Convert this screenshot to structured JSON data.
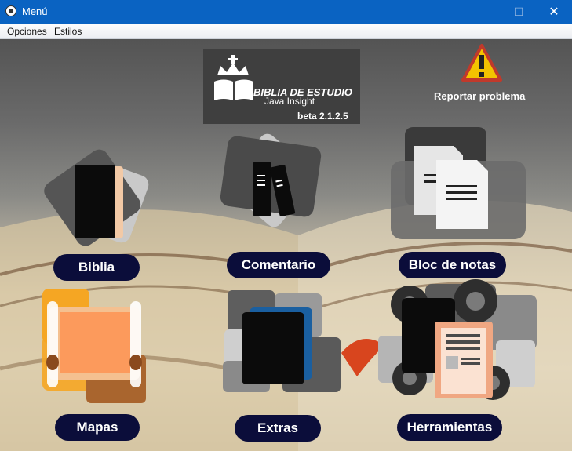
{
  "window": {
    "title": "Menú",
    "minimize": "—",
    "maximize": "☐",
    "close": "✕"
  },
  "menubar": {
    "items": [
      "Opciones",
      "Estilos"
    ]
  },
  "logo": {
    "title": "BIBLIA DE ESTUDIO",
    "subtitle": "Java Insight",
    "version": "beta 2.1.2.5"
  },
  "report": {
    "label": "Reportar problema",
    "icon": "warning-icon"
  },
  "tiles": {
    "biblia": {
      "label": "Biblia",
      "icon": "bible-book-icon"
    },
    "comentario": {
      "label": "Comentario",
      "icon": "books-icon"
    },
    "bloc": {
      "label": "Bloc de notas",
      "icon": "notes-icon"
    },
    "mapas": {
      "label": "Mapas",
      "icon": "scroll-map-icon"
    },
    "extras": {
      "label": "Extras",
      "icon": "extras-book-icon"
    },
    "herramientas": {
      "label": "Herramientas",
      "icon": "tools-gears-icon"
    }
  },
  "colors": {
    "titlebar": "#0a63c2",
    "pill": "#0b0d3a"
  }
}
